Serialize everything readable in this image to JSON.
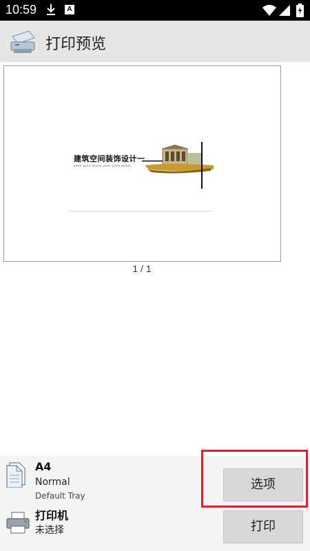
{
  "status_bar": {
    "time": "10:59",
    "notification_letter": "A",
    "icons": [
      "download-icon",
      "a-notification-icon",
      "wifi-icon",
      "signal-icon",
      "battery-icon"
    ]
  },
  "app_bar": {
    "title": "打印预览",
    "icon": "printer-app-icon",
    "background": "#e6e6e6"
  },
  "preview": {
    "doc_title": "建筑空间装饰设计一",
    "doc_subtitle": "xxxx xxxx xxxxx xxxx xxxx xxxxx",
    "page_indicator": "1 / 1"
  },
  "bottom": {
    "paper_size": "A4",
    "paper_type": "Normal",
    "paper_tray": "Default Tray",
    "printer_label": "打印机",
    "printer_status": "未选择",
    "options_button": "选项",
    "print_button": "打印",
    "highlight_color": "#e0202c"
  }
}
